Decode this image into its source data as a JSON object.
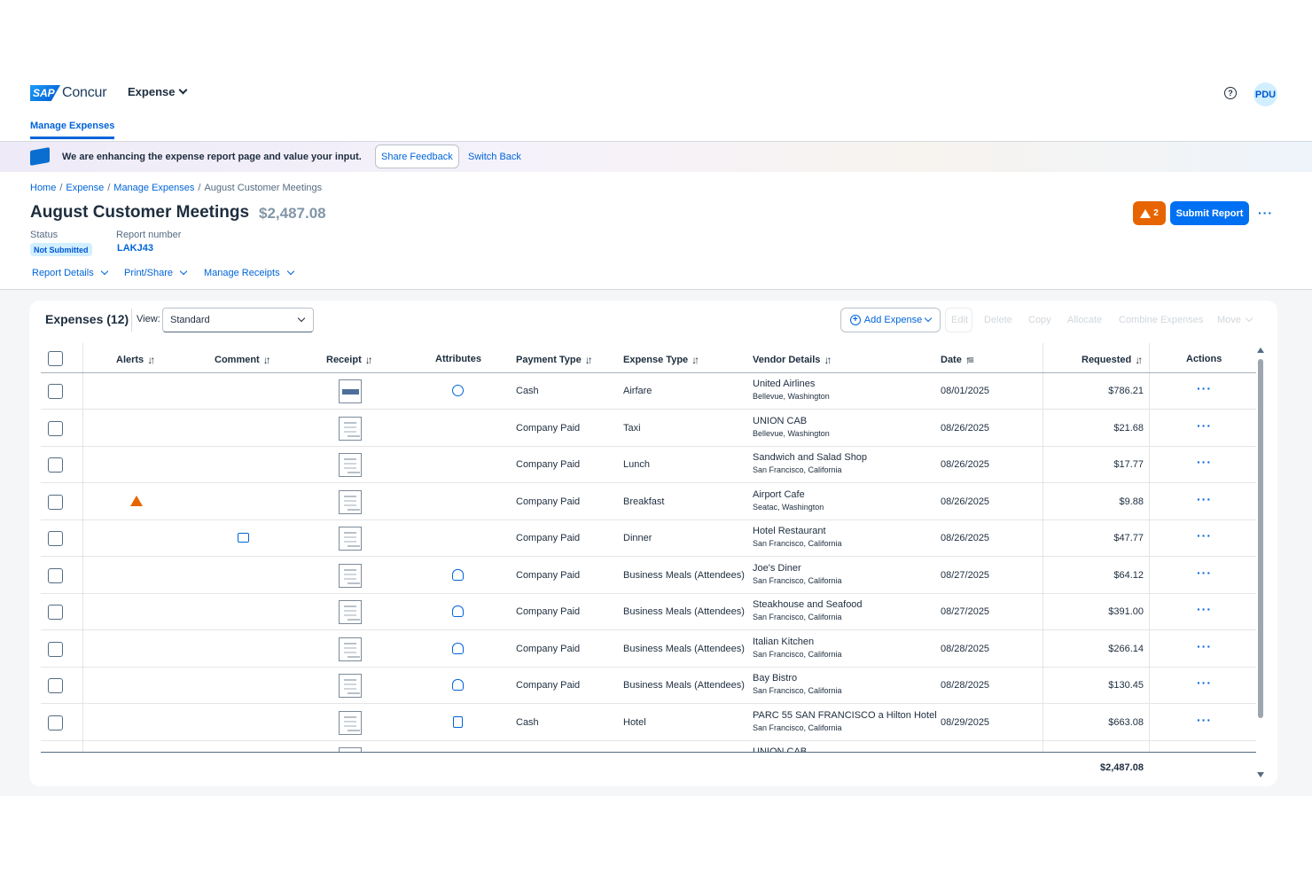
{
  "header": {
    "logo_sap": "SAP",
    "logo_text": "Concur",
    "product": "Expense",
    "avatar": "PDU",
    "help_icon": "?",
    "nav_tab": "Manage Expenses"
  },
  "banner": {
    "message": "We are enhancing the expense report page and value your input.",
    "share_feedback": "Share Feedback",
    "switch_back": "Switch Back"
  },
  "breadcrumb": {
    "items": [
      "Home",
      "Expense",
      "Manage Expenses"
    ],
    "sep": "/",
    "current": "August Customer Meetings"
  },
  "report": {
    "title": "August Customer Meetings",
    "amount": "$2,487.08",
    "status_label": "Status",
    "status": "Not Submitted",
    "number_label": "Report number",
    "number": "LAKJ43",
    "alert_count": "2",
    "submit": "Submit Report",
    "more": "···",
    "menus": [
      "Report Details",
      "Print/Share",
      "Manage Receipts"
    ]
  },
  "expenses": {
    "title": "Expenses (12)",
    "view_label": "View:",
    "view_value": "Standard",
    "add_expense": "Add Expense",
    "tools": [
      "Edit",
      "Delete",
      "Copy",
      "Allocate",
      "Combine Expenses",
      "Move"
    ],
    "columns": {
      "alerts": "Alerts",
      "comment": "Comment",
      "receipt": "Receipt",
      "attributes": "Attributes",
      "payment": "Payment Type",
      "expense_type": "Expense Type",
      "vendor": "Vendor Details",
      "date": "Date",
      "requested": "Requested",
      "actions": "Actions"
    },
    "rows": [
      {
        "payment": "Cash",
        "type": "Airfare",
        "vendor": "United Airlines",
        "location": "Bellevue, Washington",
        "date": "08/01/2025",
        "amount": "$786.21"
      },
      {
        "payment": "Company Paid",
        "type": "Taxi",
        "vendor": "UNION CAB",
        "location": "Bellevue, Washington",
        "date": "08/26/2025",
        "amount": "$21.68"
      },
      {
        "payment": "Company Paid",
        "type": "Lunch",
        "vendor": "Sandwich and Salad Shop",
        "location": "San Francisco, California",
        "date": "08/26/2025",
        "amount": "$17.77"
      },
      {
        "payment": "Company Paid",
        "type": "Breakfast",
        "vendor": "Airport Cafe",
        "location": "Seatac, Washington",
        "date": "08/26/2025",
        "amount": "$9.88"
      },
      {
        "payment": "Company Paid",
        "type": "Dinner",
        "vendor": "Hotel Restaurant",
        "location": "San Francisco, California",
        "date": "08/26/2025",
        "amount": "$47.77"
      },
      {
        "payment": "Company Paid",
        "type": "Business Meals (Attendees)",
        "vendor": "Joe's Diner",
        "location": "San Francisco, California",
        "date": "08/27/2025",
        "amount": "$64.12"
      },
      {
        "payment": "Company Paid",
        "type": "Business Meals (Attendees)",
        "vendor": "Steakhouse and Seafood",
        "location": "San Francisco, California",
        "date": "08/27/2025",
        "amount": "$391.00"
      },
      {
        "payment": "Company Paid",
        "type": "Business Meals (Attendees)",
        "vendor": "Italian Kitchen",
        "location": "San Francisco, California",
        "date": "08/28/2025",
        "amount": "$266.14"
      },
      {
        "payment": "Company Paid",
        "type": "Business Meals (Attendees)",
        "vendor": "Bay Bistro",
        "location": "San Francisco, California",
        "date": "08/28/2025",
        "amount": "$130.45"
      },
      {
        "payment": "Cash",
        "type": "Hotel",
        "vendor": "PARC 55 SAN FRANCISCO a Hilton Hotel",
        "location": "San Francisco, California",
        "date": "08/29/2025",
        "amount": "$663.08"
      },
      {
        "payment": "",
        "type": "",
        "vendor": "UNION CAB",
        "location": "",
        "date": "",
        "amount": ""
      }
    ],
    "row_icons": [
      {
        "attr": "chart-icon"
      },
      {
        "attr": ""
      },
      {
        "attr": ""
      },
      {
        "attr": "",
        "alert": "warning-icon"
      },
      {
        "attr": "",
        "comment": "comment-icon"
      },
      {
        "attr": "attendees-icon"
      },
      {
        "attr": "attendees-icon"
      },
      {
        "attr": "attendees-icon"
      },
      {
        "attr": "attendees-icon"
      },
      {
        "attr": "clipboard-icon"
      },
      {
        "attr": ""
      }
    ],
    "total": "$2,487.08",
    "action_more": "···",
    "sort_glyph": "↓↑",
    "date_sort_glyph": "↑≡"
  },
  "colors": {
    "accent": "#0064d9",
    "primary_button": "#0070f2",
    "warning": "#e76500",
    "badge_bg": "#d1efff"
  }
}
